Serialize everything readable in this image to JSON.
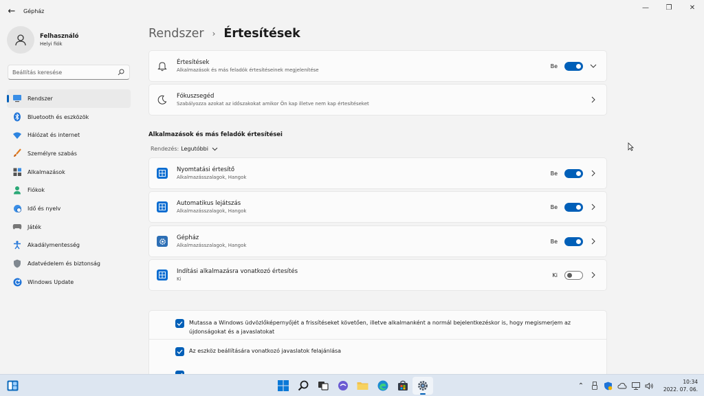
{
  "window": {
    "title": "Gépház",
    "back_glyph": "←",
    "controls": {
      "minimize": "—",
      "maximize": "❐",
      "close": "✕"
    }
  },
  "user": {
    "name": "Felhasználó",
    "account": "Helyi fiók"
  },
  "search": {
    "placeholder": "Beállítás keresése"
  },
  "nav": [
    {
      "label": "Rendszer",
      "icon": "monitor-icon",
      "active": true
    },
    {
      "label": "Bluetooth és eszközök",
      "icon": "bluetooth-icon"
    },
    {
      "label": "Hálózat és internet",
      "icon": "wifi-icon"
    },
    {
      "label": "Személyre szabás",
      "icon": "brush-icon"
    },
    {
      "label": "Alkalmazások",
      "icon": "apps-icon"
    },
    {
      "label": "Fiókok",
      "icon": "person-icon"
    },
    {
      "label": "Idő és nyelv",
      "icon": "globe-clock-icon"
    },
    {
      "label": "Játék",
      "icon": "gamepad-icon"
    },
    {
      "label": "Akadálymentesség",
      "icon": "accessibility-icon"
    },
    {
      "label": "Adatvédelem és biztonság",
      "icon": "shield-icon"
    },
    {
      "label": "Windows Update",
      "icon": "update-icon"
    }
  ],
  "breadcrumb": {
    "parent": "Rendszer",
    "separator": "›",
    "current": "Értesítések"
  },
  "notifications": {
    "title": "Értesítések",
    "subtitle": "Alkalmazások és más feladók értesítéseinek megjelenítése",
    "state": "Be",
    "on": true
  },
  "focus": {
    "title": "Fókuszsegéd",
    "subtitle": "Szabályozza azokat az időszakokat amikor Ön kap illetve nem kap értesítéseket"
  },
  "section": {
    "title": "Alkalmazások és más feladók értesítései"
  },
  "sort": {
    "label": "Rendezés:",
    "value": "Legutóbbi"
  },
  "senders": [
    {
      "title": "Nyomtatási értesítő",
      "subtitle": "Alkalmazásszalagok, Hangok",
      "state": "Be",
      "on": true,
      "icon": "app-tile-icon"
    },
    {
      "title": "Automatikus lejátszás",
      "subtitle": "Alkalmazásszalagok, Hangok",
      "state": "Be",
      "on": true,
      "icon": "app-tile-icon"
    },
    {
      "title": "Gépház",
      "subtitle": "Alkalmazásszalagok, Hangok",
      "state": "Be",
      "on": true,
      "icon": "settings-gear-icon"
    },
    {
      "title": "Indítási alkalmazásra vonatkozó értesítés",
      "subtitle": "Ki",
      "state": "Ki",
      "on": false,
      "icon": "app-tile-icon"
    }
  ],
  "checks": [
    {
      "text": "Mutassa a Windows üdvözlőképernyőjét a frissítéseket követően, illetve alkalmanként a normál bejelentkezéskor is, hogy megismerjem az újdonságokat és a javaslatokat",
      "checked": true
    },
    {
      "text": "Az eszköz beállítására vonatkozó javaslatok felajánlása",
      "checked": true
    }
  ],
  "taskbar": {
    "apps": [
      "start-icon",
      "search-icon",
      "task-view-icon",
      "chat-icon",
      "file-explorer-icon",
      "edge-icon",
      "store-icon",
      "settings-icon"
    ],
    "tray": {
      "chevron": "⌃"
    },
    "clock": {
      "time": "10:34",
      "date": "2022. 07. 06."
    }
  },
  "colors": {
    "accent": "#005fb8",
    "background": "#f3f3f3",
    "card": "#fbfbfb",
    "taskbar": "#dde6f1"
  }
}
